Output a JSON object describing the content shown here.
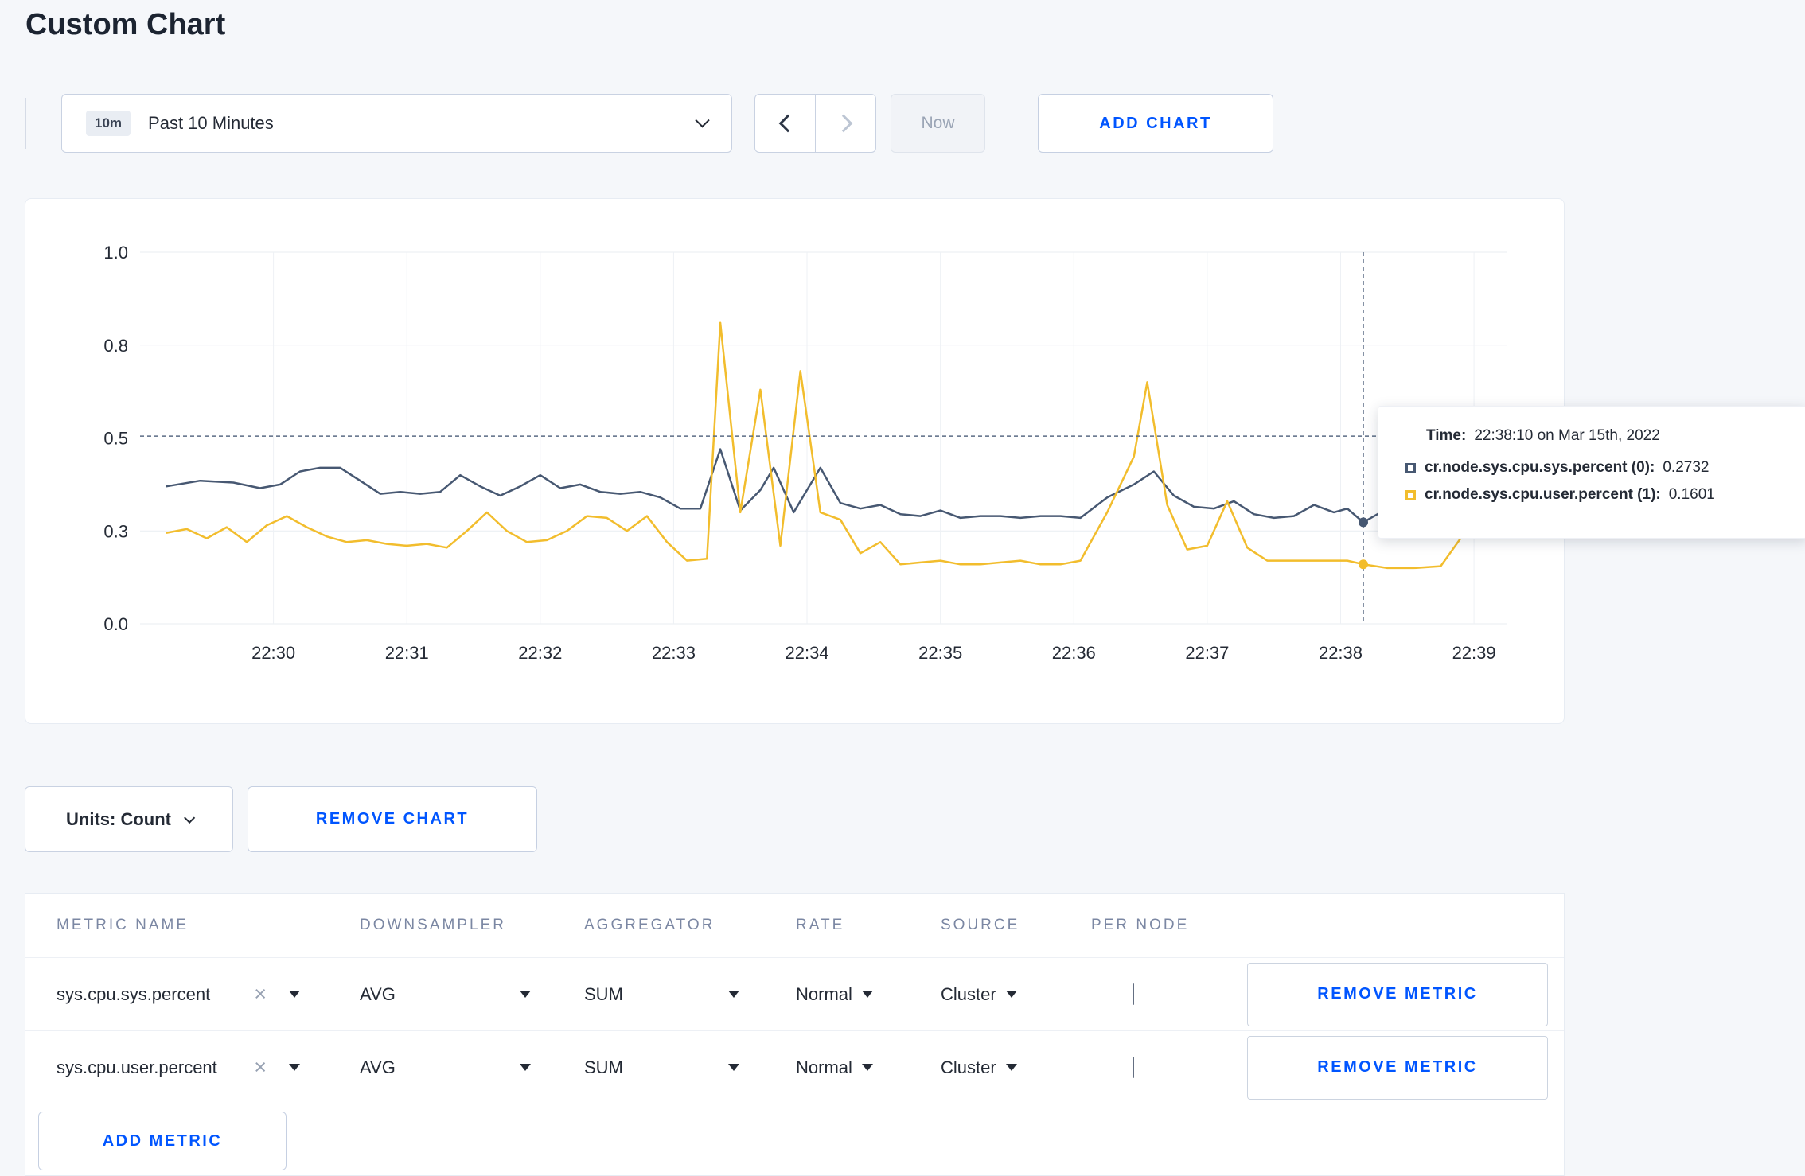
{
  "page": {
    "title": "Custom Chart"
  },
  "toolbar": {
    "time_range": {
      "badge": "10m",
      "label": "Past 10 Minutes"
    },
    "now_label": "Now",
    "add_chart_label": "ADD CHART"
  },
  "chart_controls": {
    "units_label": "Units: Count",
    "remove_chart_label": "REMOVE CHART"
  },
  "tooltip": {
    "time_label": "Time:",
    "time_value": "22:38:10 on Mar 15th, 2022",
    "series": [
      {
        "label": "cr.node.sys.cpu.sys.percent (0):",
        "value": "0.2732",
        "color": "#475872"
      },
      {
        "label": "cr.node.sys.cpu.user.percent (1):",
        "value": "0.1601",
        "color": "#f2bd2d"
      }
    ]
  },
  "chart_data": {
    "type": "line",
    "title": "",
    "xlabel": "",
    "ylabel": "",
    "x_unit": "minutes after 22:29",
    "x_range": [
      0,
      10.25
    ],
    "y_range": [
      0,
      1
    ],
    "grid": true,
    "x_ticks": [
      {
        "t": 1,
        "label": "22:30"
      },
      {
        "t": 2,
        "label": "22:31"
      },
      {
        "t": 3,
        "label": "22:32"
      },
      {
        "t": 4,
        "label": "22:33"
      },
      {
        "t": 5,
        "label": "22:34"
      },
      {
        "t": 6,
        "label": "22:35"
      },
      {
        "t": 7,
        "label": "22:36"
      },
      {
        "t": 8,
        "label": "22:37"
      },
      {
        "t": 9,
        "label": "22:38"
      },
      {
        "t": 10,
        "label": "22:39"
      }
    ],
    "y_ticks": [
      {
        "v": 0,
        "label": "0.0"
      },
      {
        "v": 0.25,
        "label": "0.3"
      },
      {
        "v": 0.5,
        "label": "0.5"
      },
      {
        "v": 0.75,
        "label": "0.8"
      },
      {
        "v": 1,
        "label": "1.0"
      }
    ],
    "crosshair": {
      "t": 9.17,
      "y_value": 0.505
    },
    "hover_points": [
      {
        "t": 9.17,
        "v": 0.2732,
        "series": 0
      },
      {
        "t": 9.17,
        "v": 0.1601,
        "series": 1
      }
    ],
    "series": [
      {
        "name": "cr.node.sys.cpu.sys.percent",
        "color": "#475872",
        "points": [
          [
            0.2,
            0.37
          ],
          [
            0.45,
            0.385
          ],
          [
            0.7,
            0.38
          ],
          [
            0.9,
            0.365
          ],
          [
            1.05,
            0.375
          ],
          [
            1.2,
            0.41
          ],
          [
            1.35,
            0.42
          ],
          [
            1.5,
            0.42
          ],
          [
            1.65,
            0.385
          ],
          [
            1.8,
            0.35
          ],
          [
            1.95,
            0.355
          ],
          [
            2.1,
            0.35
          ],
          [
            2.25,
            0.355
          ],
          [
            2.4,
            0.4
          ],
          [
            2.55,
            0.37
          ],
          [
            2.7,
            0.345
          ],
          [
            2.85,
            0.37
          ],
          [
            3.0,
            0.4
          ],
          [
            3.15,
            0.365
          ],
          [
            3.3,
            0.375
          ],
          [
            3.45,
            0.355
          ],
          [
            3.6,
            0.35
          ],
          [
            3.75,
            0.355
          ],
          [
            3.9,
            0.34
          ],
          [
            4.05,
            0.31
          ],
          [
            4.2,
            0.31
          ],
          [
            4.35,
            0.47
          ],
          [
            4.5,
            0.305
          ],
          [
            4.65,
            0.36
          ],
          [
            4.75,
            0.42
          ],
          [
            4.9,
            0.3
          ],
          [
            5.0,
            0.36
          ],
          [
            5.1,
            0.42
          ],
          [
            5.25,
            0.325
          ],
          [
            5.4,
            0.31
          ],
          [
            5.55,
            0.32
          ],
          [
            5.7,
            0.295
          ],
          [
            5.85,
            0.29
          ],
          [
            6.0,
            0.305
          ],
          [
            6.15,
            0.285
          ],
          [
            6.3,
            0.29
          ],
          [
            6.45,
            0.29
          ],
          [
            6.6,
            0.285
          ],
          [
            6.75,
            0.29
          ],
          [
            6.9,
            0.29
          ],
          [
            7.05,
            0.285
          ],
          [
            7.25,
            0.34
          ],
          [
            7.45,
            0.375
          ],
          [
            7.6,
            0.41
          ],
          [
            7.75,
            0.345
          ],
          [
            7.9,
            0.315
          ],
          [
            8.05,
            0.31
          ],
          [
            8.2,
            0.33
          ],
          [
            8.35,
            0.295
          ],
          [
            8.5,
            0.285
          ],
          [
            8.65,
            0.29
          ],
          [
            8.8,
            0.32
          ],
          [
            8.95,
            0.3
          ],
          [
            9.05,
            0.31
          ],
          [
            9.17,
            0.2732
          ],
          [
            9.3,
            0.3
          ],
          [
            9.5,
            0.29
          ],
          [
            9.7,
            0.3
          ],
          [
            9.9,
            0.295
          ]
        ]
      },
      {
        "name": "cr.node.sys.cpu.user.percent",
        "color": "#f2bd2d",
        "points": [
          [
            0.2,
            0.245
          ],
          [
            0.35,
            0.255
          ],
          [
            0.5,
            0.23
          ],
          [
            0.65,
            0.26
          ],
          [
            0.8,
            0.22
          ],
          [
            0.95,
            0.265
          ],
          [
            1.1,
            0.29
          ],
          [
            1.25,
            0.26
          ],
          [
            1.4,
            0.235
          ],
          [
            1.55,
            0.22
          ],
          [
            1.7,
            0.225
          ],
          [
            1.85,
            0.215
          ],
          [
            2.0,
            0.21
          ],
          [
            2.15,
            0.215
          ],
          [
            2.3,
            0.205
          ],
          [
            2.45,
            0.25
          ],
          [
            2.6,
            0.3
          ],
          [
            2.75,
            0.25
          ],
          [
            2.9,
            0.22
          ],
          [
            3.05,
            0.225
          ],
          [
            3.2,
            0.25
          ],
          [
            3.35,
            0.29
          ],
          [
            3.5,
            0.285
          ],
          [
            3.65,
            0.25
          ],
          [
            3.8,
            0.29
          ],
          [
            3.95,
            0.22
          ],
          [
            4.1,
            0.17
          ],
          [
            4.25,
            0.175
          ],
          [
            4.35,
            0.81
          ],
          [
            4.5,
            0.3
          ],
          [
            4.65,
            0.63
          ],
          [
            4.8,
            0.21
          ],
          [
            4.95,
            0.68
          ],
          [
            5.1,
            0.3
          ],
          [
            5.25,
            0.28
          ],
          [
            5.4,
            0.19
          ],
          [
            5.55,
            0.22
          ],
          [
            5.7,
            0.16
          ],
          [
            5.85,
            0.165
          ],
          [
            6.0,
            0.17
          ],
          [
            6.15,
            0.16
          ],
          [
            6.3,
            0.16
          ],
          [
            6.45,
            0.165
          ],
          [
            6.6,
            0.17
          ],
          [
            6.75,
            0.16
          ],
          [
            6.9,
            0.16
          ],
          [
            7.05,
            0.17
          ],
          [
            7.25,
            0.3
          ],
          [
            7.45,
            0.45
          ],
          [
            7.55,
            0.65
          ],
          [
            7.7,
            0.32
          ],
          [
            7.85,
            0.2
          ],
          [
            8.0,
            0.21
          ],
          [
            8.15,
            0.33
          ],
          [
            8.3,
            0.205
          ],
          [
            8.45,
            0.17
          ],
          [
            8.6,
            0.17
          ],
          [
            8.75,
            0.17
          ],
          [
            8.9,
            0.17
          ],
          [
            9.05,
            0.17
          ],
          [
            9.17,
            0.1601
          ],
          [
            9.35,
            0.15
          ],
          [
            9.55,
            0.15
          ],
          [
            9.75,
            0.155
          ],
          [
            9.9,
            0.23
          ],
          [
            10.0,
            0.275
          ],
          [
            10.1,
            0.24
          ]
        ]
      }
    ]
  },
  "metrics_table": {
    "headers": [
      "METRIC NAME",
      "DOWNSAMPLER",
      "AGGREGATOR",
      "RATE",
      "SOURCE",
      "PER NODE"
    ],
    "rows": [
      {
        "metric": "sys.cpu.sys.percent",
        "downsampler": "AVG",
        "aggregator": "SUM",
        "rate": "Normal",
        "source": "Cluster",
        "per_node": false,
        "remove_label": "REMOVE METRIC"
      },
      {
        "metric": "sys.cpu.user.percent",
        "downsampler": "AVG",
        "aggregator": "SUM",
        "rate": "Normal",
        "source": "Cluster",
        "per_node": false,
        "remove_label": "REMOVE METRIC"
      }
    ],
    "add_metric_label": "ADD METRIC"
  },
  "colors": {
    "accent_blue": "#0055ff",
    "series_dark": "#475872",
    "series_yellow": "#f2bd2d",
    "page_background": "#f5f7fa"
  }
}
